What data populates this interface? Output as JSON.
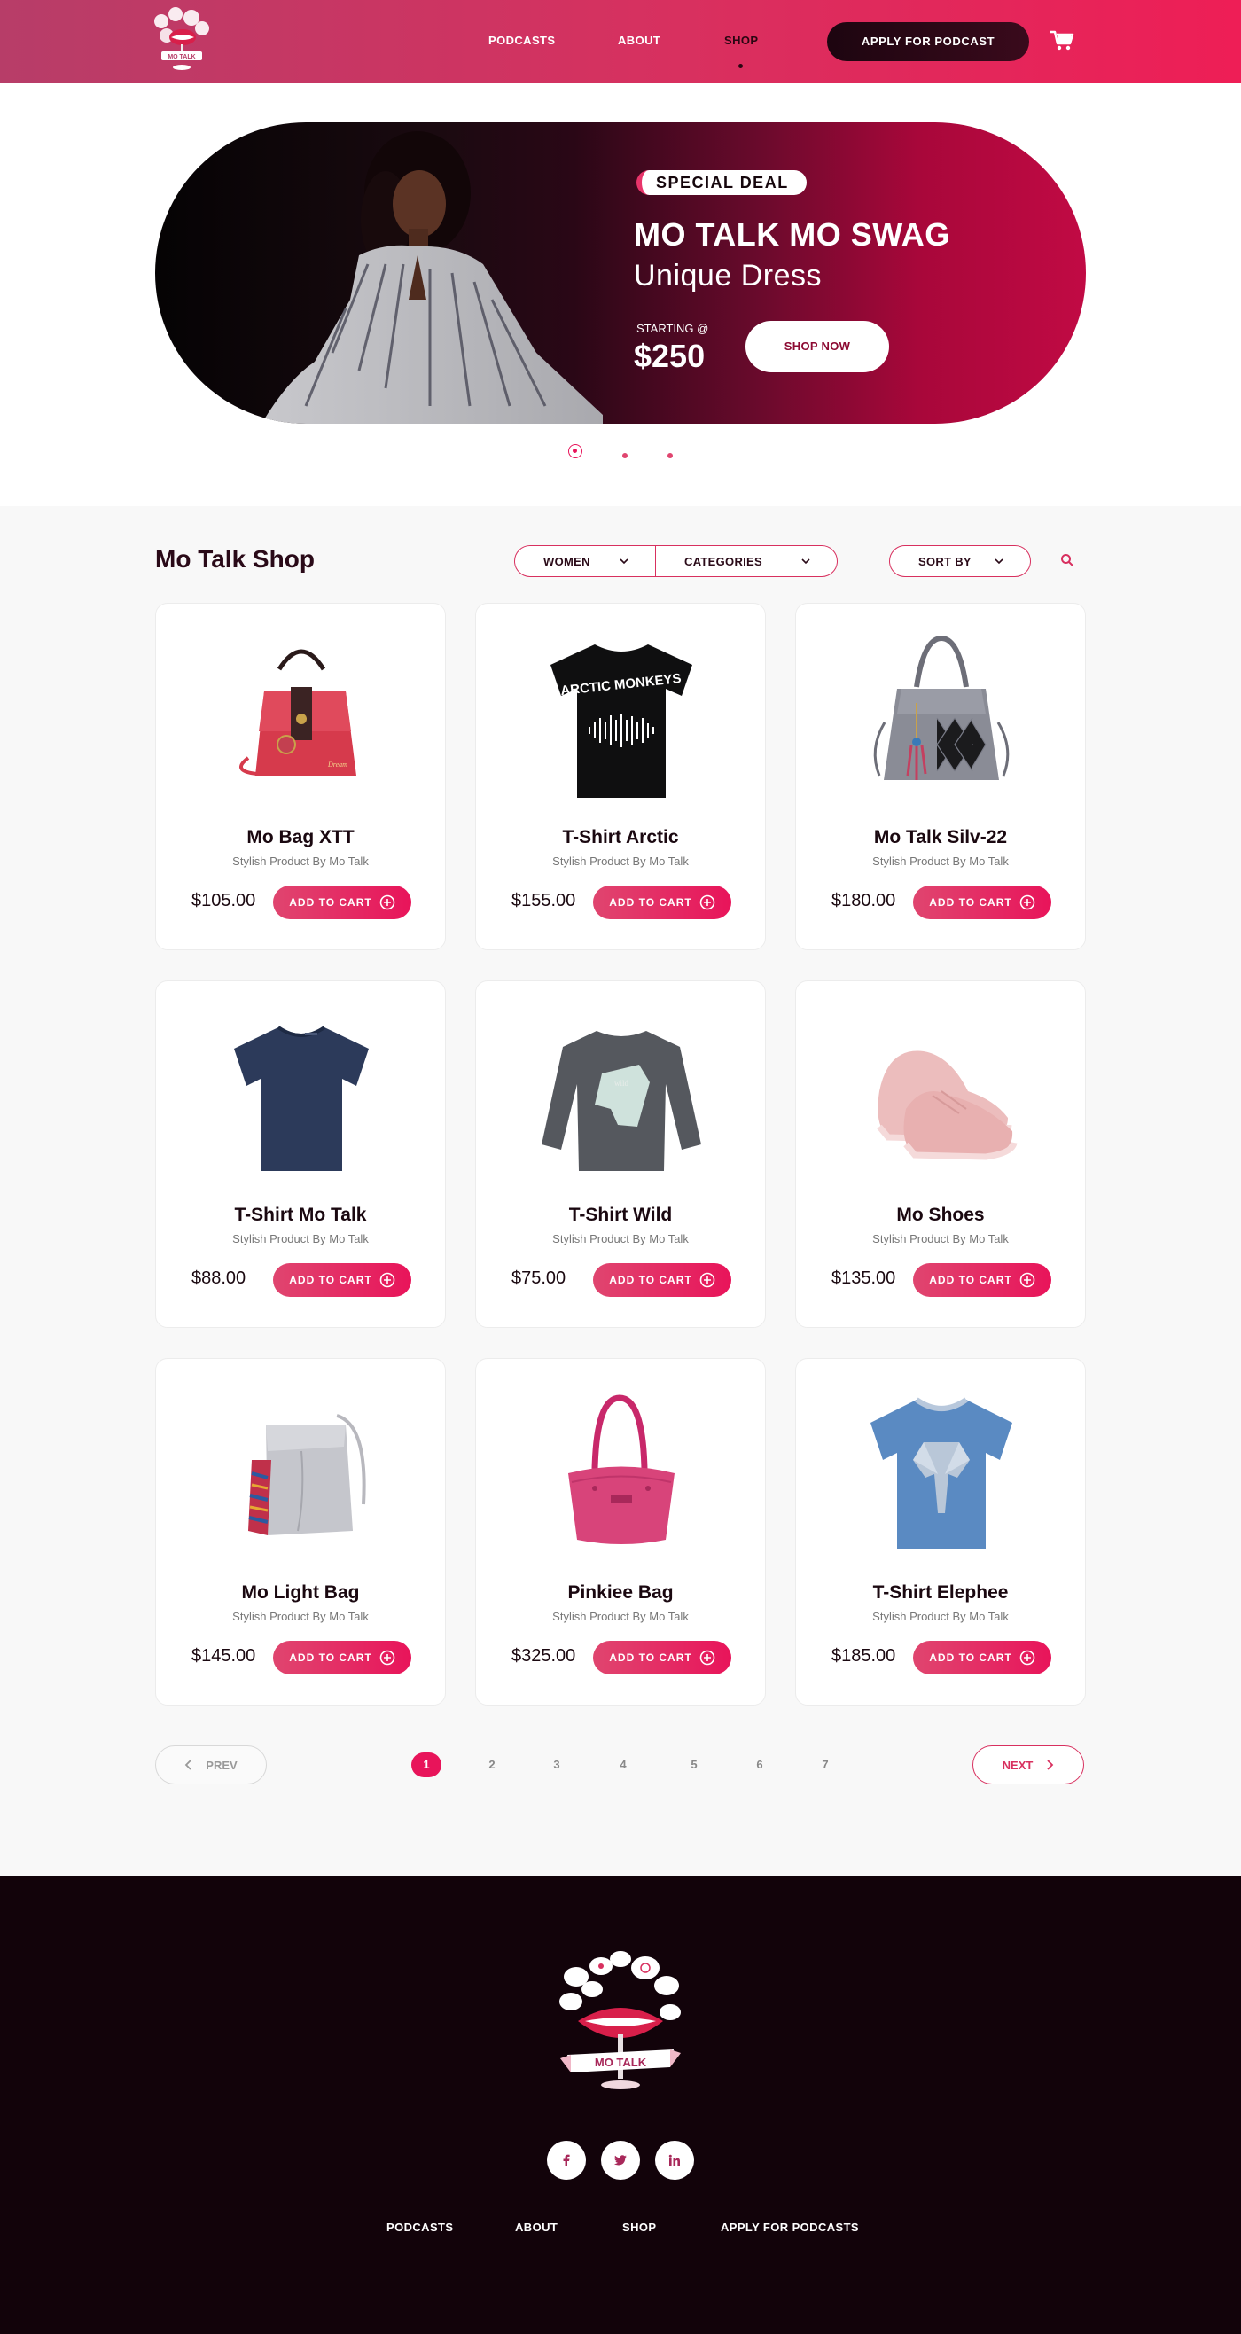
{
  "header": {
    "logo_text": "MO TALK",
    "nav": [
      "PODCASTS",
      "ABOUT",
      "SHOP"
    ],
    "active_nav": "SHOP",
    "apply_label": "APPLY FOR PODCAST",
    "cart_icon": "cart-icon"
  },
  "hero": {
    "badge": "SPECIAL DEAL",
    "title": "MO TALK MO SWAG",
    "subtitle": "Unique Dress",
    "starting_label": "STARTING @",
    "price": "$250",
    "cta": "SHOP NOW",
    "slide_count": 3,
    "active_slide": 1
  },
  "shop": {
    "title": "Mo Talk Shop",
    "filter_gender": "WOMEN",
    "filter_categories": "CATEGORIES",
    "sort_label": "SORT BY",
    "search_icon": "search-icon",
    "add_to_cart_label": "ADD TO CART",
    "products": [
      {
        "name": "Mo Bag XTT",
        "desc": "Stylish Product By Mo Talk",
        "price": "$105.00",
        "image": "red-handbag"
      },
      {
        "name": "T-Shirt Arctic",
        "desc": "Stylish Product By Mo Talk",
        "price": "$155.00",
        "image": "black-tshirt",
        "print": "ARCTIC MONKEYS"
      },
      {
        "name": "Mo Talk Silv-22",
        "desc": "Stylish Product By Mo Talk",
        "price": "$180.00",
        "image": "grey-handbag"
      },
      {
        "name": "T-Shirt Mo Talk",
        "desc": "Stylish Product By Mo Talk",
        "price": "$88.00",
        "image": "navy-tshirt"
      },
      {
        "name": "T-Shirt Wild",
        "desc": "Stylish Product By Mo Talk",
        "price": "$75.00",
        "image": "grey-sweatshirt"
      },
      {
        "name": "Mo Shoes",
        "desc": "Stylish Product By Mo Talk",
        "price": "$135.00",
        "image": "pink-sneakers"
      },
      {
        "name": "Mo Light Bag",
        "desc": "Stylish Product By Mo Talk",
        "price": "$145.00",
        "image": "silver-bucket-bag"
      },
      {
        "name": "Pinkiee Bag",
        "desc": "Stylish Product By Mo Talk",
        "price": "$325.00",
        "image": "pink-tote"
      },
      {
        "name": "T-Shirt Elephee",
        "desc": "Stylish Product By Mo Talk",
        "price": "$185.00",
        "image": "blue-elephant-tshirt"
      }
    ]
  },
  "pagination": {
    "prev": "PREV",
    "next": "NEXT",
    "pages": [
      "1",
      "2",
      "3",
      "4",
      "5",
      "6",
      "7"
    ],
    "current": "1"
  },
  "footer": {
    "logo_text": "MO TALK",
    "social": [
      "facebook-icon",
      "twitter-icon",
      "linkedin-icon"
    ],
    "links": [
      "PODCASTS",
      "ABOUT",
      "SHOP",
      "APPLY FOR PODCASTS"
    ]
  },
  "colors": {
    "brand_pink": "#e8145a",
    "brand_dark": "#12030a",
    "brand_mauve": "#b73d68"
  }
}
